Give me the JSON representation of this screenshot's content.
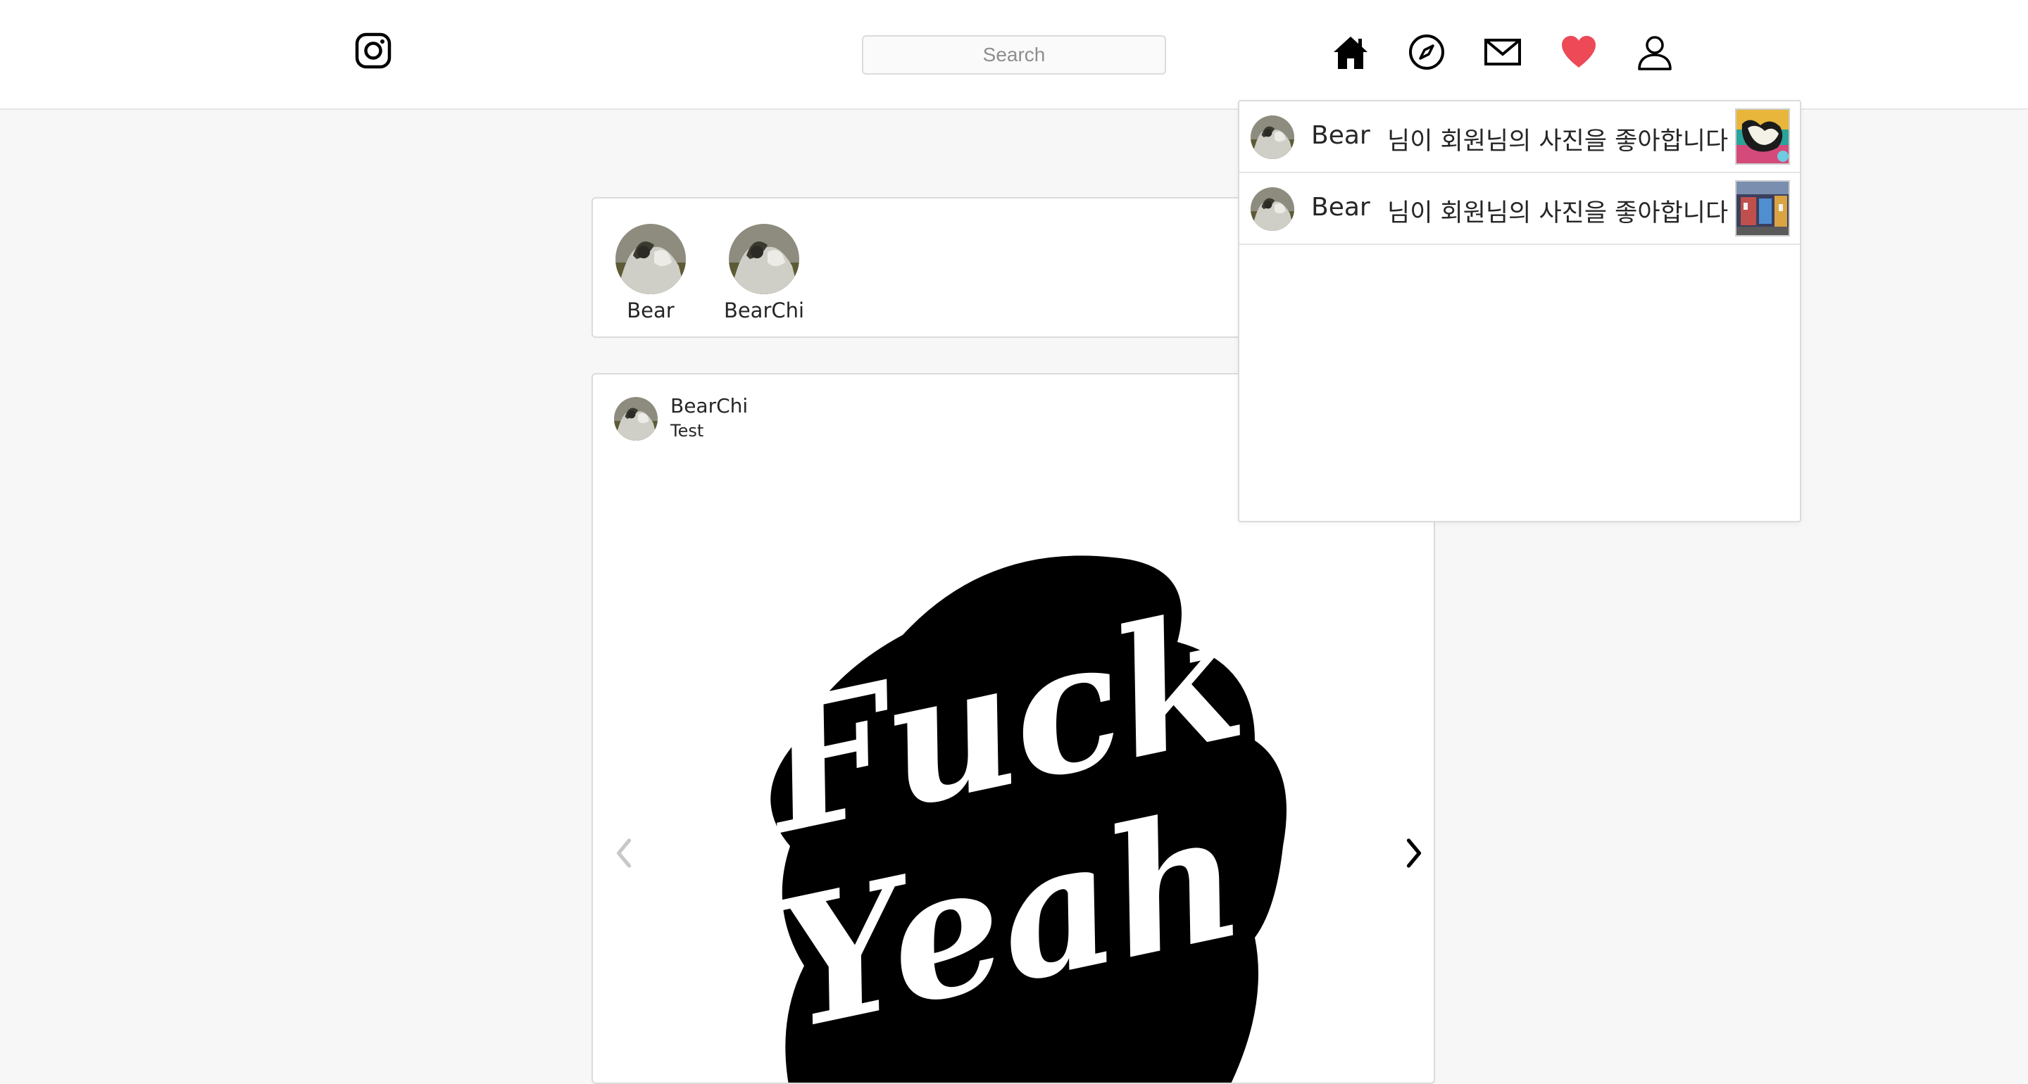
{
  "header": {
    "logo_icon": "instagram-logo-icon",
    "search": {
      "placeholder": "Search",
      "value": ""
    },
    "nav": [
      {
        "id": "home",
        "icon": "home-icon"
      },
      {
        "id": "explore",
        "icon": "compass-icon"
      },
      {
        "id": "messages",
        "icon": "mail-icon"
      },
      {
        "id": "activity",
        "icon": "heart-icon",
        "active": true
      },
      {
        "id": "profile",
        "icon": "user-icon"
      }
    ],
    "active_color": "#ed4956"
  },
  "stories": [
    {
      "name": "Bear"
    },
    {
      "name": "BearChi"
    }
  ],
  "post": {
    "username": "BearChi",
    "location": "Test",
    "image_text": [
      "Fuck",
      "Yeah"
    ],
    "prev_icon": "chevron-left-icon",
    "next_icon": "chevron-right-icon"
  },
  "notifications": [
    {
      "user": "Bear",
      "text": "님이 회원님의 사진을 좋아합니다"
    },
    {
      "user": "Bear",
      "text": "님이 회원님의 사진을 좋아합니다"
    }
  ]
}
